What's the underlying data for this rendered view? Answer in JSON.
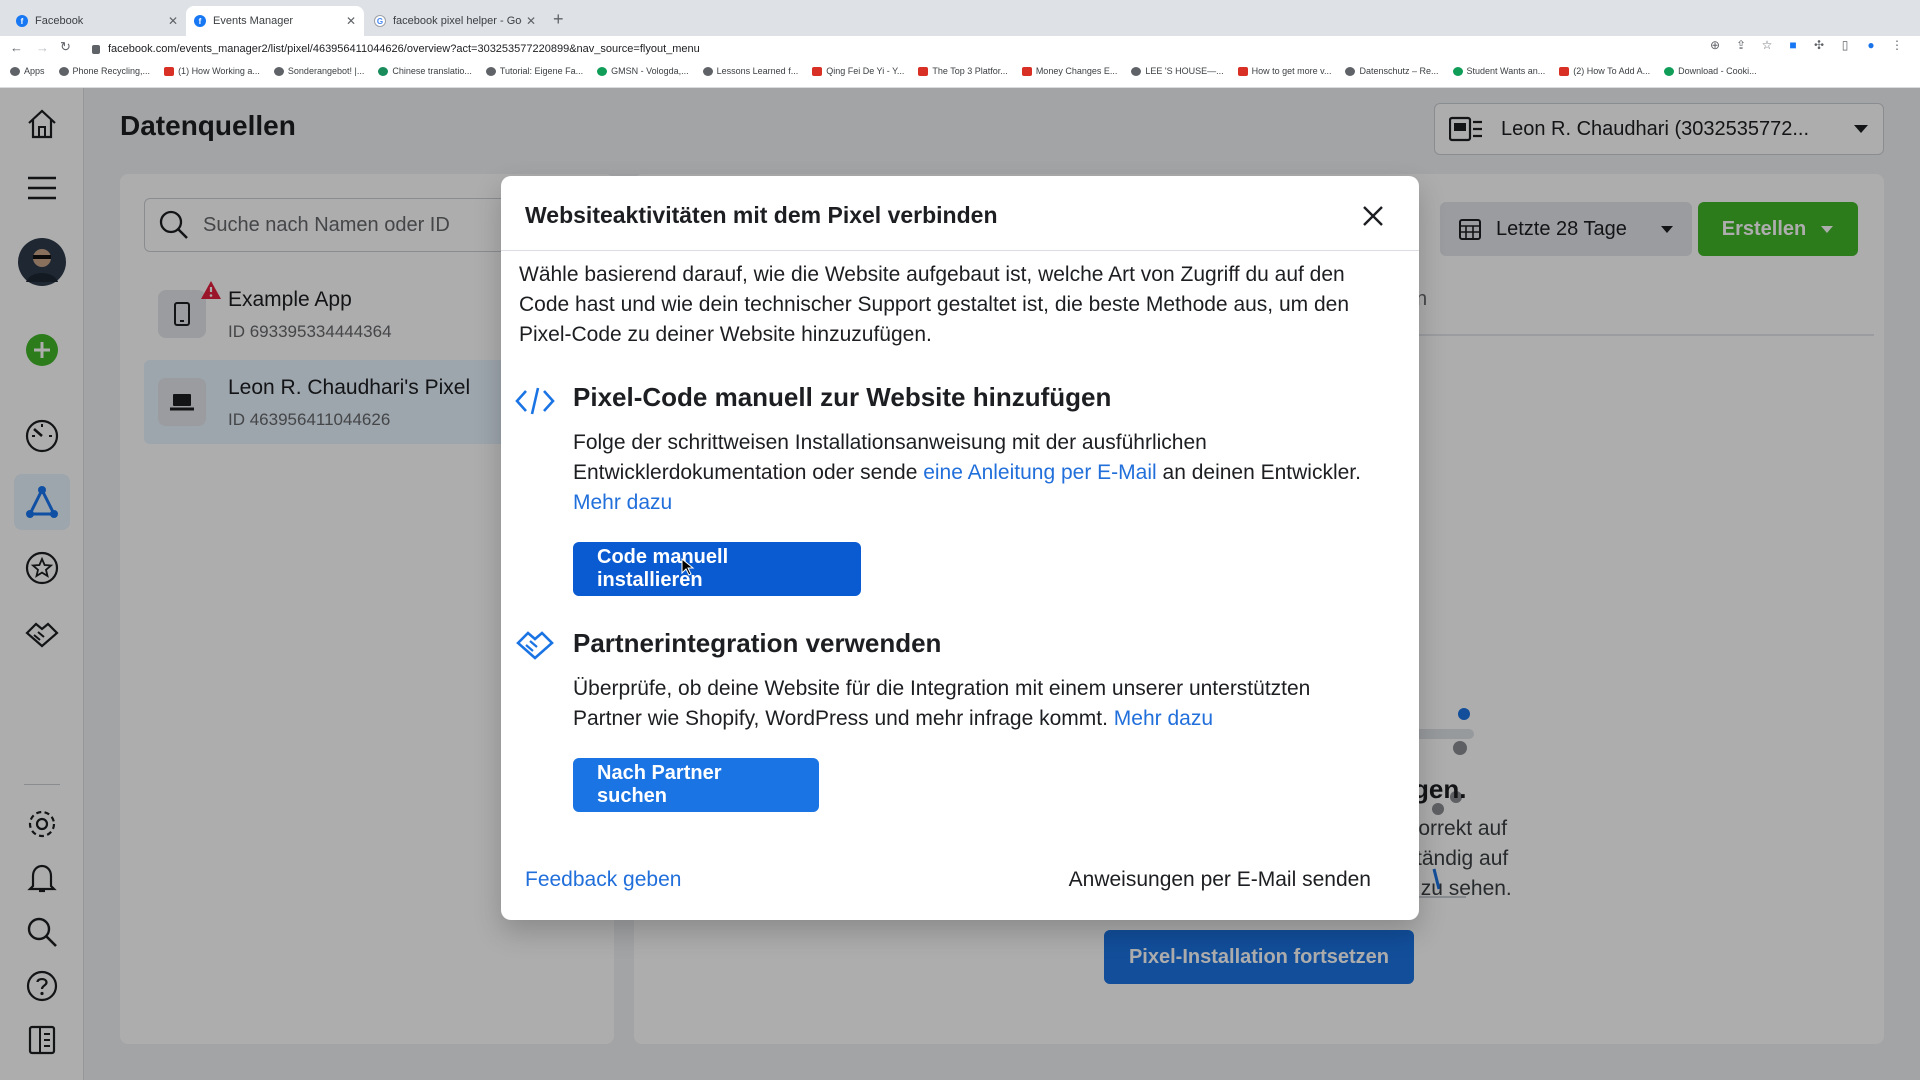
{
  "browser": {
    "tabs": [
      {
        "title": "Facebook",
        "icon": "facebook-icon"
      },
      {
        "title": "Events Manager",
        "icon": "facebook-icon"
      },
      {
        "title": "facebook pixel helper - Google",
        "icon": "google-icon"
      }
    ],
    "url": "facebook.com/events_manager2/list/pixel/463956411044626/overview?act=303253577220899&nav_source=flyout_menu",
    "bookmarks": [
      "Apps",
      "Phone Recycling,...",
      "(1) How Working a...",
      "Sonderangebot! |...",
      "Chinese translatio...",
      "Tutorial: Eigene Fa...",
      "GMSN - Vologda,...",
      "Lessons Learned f...",
      "Qing Fei De Yi - Y...",
      "The Top 3 Platfor...",
      "Money Changes E...",
      "LEE 'S HOUSE—...",
      "How to get more v...",
      "Datenschutz – Re...",
      "Student Wants an...",
      "(2) How To Add A...",
      "Download - Cooki..."
    ]
  },
  "page": {
    "title": "Datenquellen",
    "account": "Leon R. Chaudhari (3032535772...",
    "search_placeholder": "Suche nach Namen oder ID",
    "sources": [
      {
        "name": "Example App",
        "id": "ID 693395334444364",
        "icon": "mobile-icon",
        "warning": true
      },
      {
        "name": "Leon R. Chaudhari's Pixel",
        "id": "ID 463956411044626",
        "icon": "laptop-icon",
        "warning": false
      }
    ],
    "date_range": "Letzte 28 Tage",
    "create_button": "Erstellen",
    "tab_fragment": "n",
    "empty_title": "fangen.",
    "empty_text_lines": [
      "cht korrekt auf",
      "vollständig auf",
      "äten zu sehen."
    ],
    "continue_button": "Pixel-Installation fortsetzen"
  },
  "modal": {
    "title": "Websiteaktivitäten mit dem Pixel verbinden",
    "intro": "Wähle basierend darauf, wie die Website aufgebaut ist, welche Art von Zugriff du auf den Code hast und wie dein technischer Support gestaltet ist, die beste Methode aus, um den Pixel-Code zu deiner Website hinzuzufügen.",
    "option1": {
      "title": "Pixel-Code manuell zur Website hinzufügen",
      "text_before": "Folge der schrittweisen Installationsanweisung mit der ausführlichen Entwicklerdokumentation oder sende ",
      "link": "eine Anleitung per E-Mail",
      "text_after": " an deinen Entwickler. ",
      "more": "Mehr dazu",
      "button": "Code manuell installieren"
    },
    "option2": {
      "title": "Partnerintegration verwenden",
      "text": "Überprüfe, ob deine Website für die Integration mit einem unserer unterstützten Partner wie Shopify, WordPress und mehr infrage kommt. ",
      "more": "Mehr dazu",
      "button": "Nach Partner suchen"
    },
    "feedback": "Feedback geben",
    "email_instructions": "Anweisungen per E-Mail senden"
  },
  "colors": {
    "accent": "#1b74e4",
    "create": "#42b72a",
    "link": "#216fdb"
  }
}
